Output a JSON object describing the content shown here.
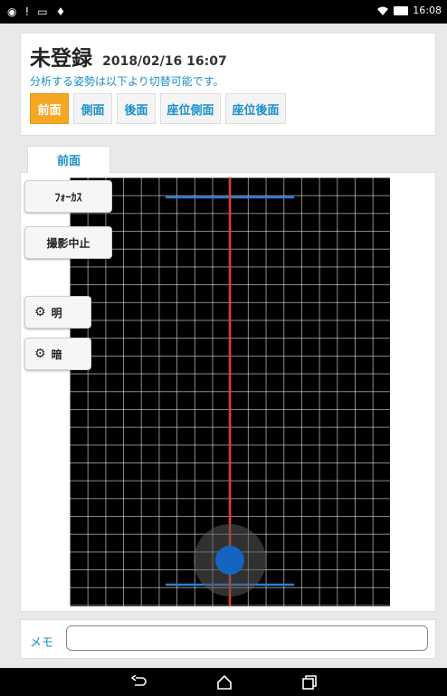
{
  "status_bar": {
    "left_icons": [
      "shield-icon",
      "alert-icon",
      "image-icon",
      "pin-icon"
    ],
    "left_glyphs": [
      "◉",
      "!",
      "▭",
      "♦"
    ],
    "time": "16:08"
  },
  "header": {
    "title": "未登録",
    "datetime": "2018/02/16 16:07",
    "hint": "分析する姿勢は以下より切替可能です。",
    "tabs": [
      {
        "label": "前面",
        "active": true
      },
      {
        "label": "側面",
        "active": false
      },
      {
        "label": "後面",
        "active": false
      },
      {
        "label": "座位側面",
        "active": false
      },
      {
        "label": "座位後面",
        "active": false
      }
    ]
  },
  "view": {
    "tab_label": "前面"
  },
  "controls": {
    "focus_label": "ﾌｫｰｶｽ",
    "stop_label": "撮影中止",
    "bright_label": "明",
    "dark_label": "暗"
  },
  "camera": {
    "center_line_color": "#e53935",
    "guide_line_color": "#2a7fd4",
    "marker_color": "#1565c0"
  },
  "memo": {
    "label": "メモ",
    "value": "",
    "placeholder": ""
  },
  "nav": {
    "icons": [
      "back-icon",
      "home-icon",
      "recent-apps-icon"
    ]
  }
}
